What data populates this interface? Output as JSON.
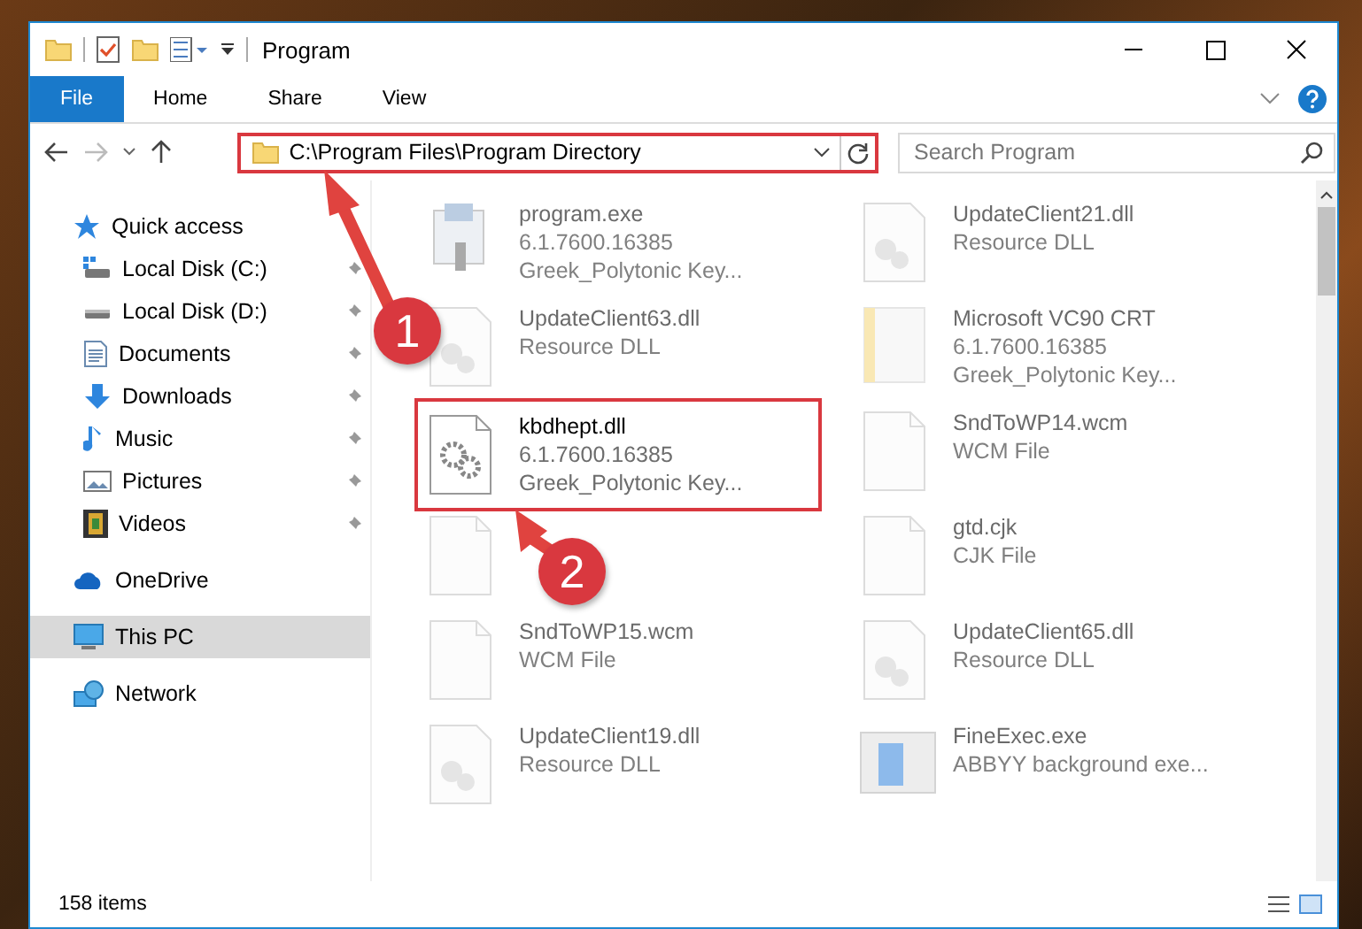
{
  "window": {
    "title": "Program"
  },
  "ribbon_tabs": [
    {
      "label": "File",
      "selected": true
    },
    {
      "label": "Home",
      "selected": false
    },
    {
      "label": "Share",
      "selected": false
    },
    {
      "label": "View",
      "selected": false
    }
  ],
  "address_bar": {
    "path": "C:\\Program Files\\Program Directory",
    "highlighted": true
  },
  "search": {
    "placeholder": "Search Program"
  },
  "nav": [
    {
      "label": "Quick access",
      "kind": "quick",
      "selected": false,
      "children": [
        {
          "label": "Local Disk (C:)",
          "kind": "disk-c",
          "pinned": true,
          "selected": false
        },
        {
          "label": "Local Disk (D:)",
          "kind": "disk",
          "pinned": true,
          "selected": false
        },
        {
          "label": "Documents",
          "kind": "documents",
          "pinned": true,
          "selected": false
        },
        {
          "label": "Downloads",
          "kind": "downloads",
          "pinned": true,
          "selected": false
        },
        {
          "label": "Music",
          "kind": "music",
          "pinned": true,
          "selected": false
        },
        {
          "label": "Pictures",
          "kind": "pictures",
          "pinned": true,
          "selected": false
        },
        {
          "label": "Videos",
          "kind": "videos",
          "pinned": true,
          "selected": false
        }
      ]
    },
    {
      "label": "OneDrive",
      "kind": "cloud",
      "selected": false
    },
    {
      "label": "This PC",
      "kind": "pc",
      "selected": true
    },
    {
      "label": "Network",
      "kind": "network",
      "selected": false
    }
  ],
  "files": [
    {
      "name": "program.exe",
      "kind": "exe",
      "highlighted": false,
      "details": [
        "6.1.7600.16385",
        "Greek_Polytonic Key..."
      ]
    },
    {
      "name": "UpdateClient21.dll",
      "kind": "dll",
      "highlighted": false,
      "details": [
        "Resource DLL"
      ]
    },
    {
      "name": "UpdateClient63.dll",
      "kind": "dll",
      "highlighted": false,
      "details": [
        "Resource DLL"
      ]
    },
    {
      "name": "Microsoft VC90 CRT",
      "kind": "folder",
      "highlighted": false,
      "details": [
        "6.1.7600.16385",
        "Greek_Polytonic Key..."
      ]
    },
    {
      "name": "kbdhept.dll",
      "kind": "gear",
      "highlighted": true,
      "details": [
        "6.1.7600.16385",
        "Greek_Polytonic Key..."
      ]
    },
    {
      "name": "SndToWP14.wcm",
      "kind": "file",
      "highlighted": false,
      "details": [
        "WCM File"
      ]
    },
    {
      "kind": "file",
      "highlighted": false
    },
    {
      "name": "gtd.cjk",
      "kind": "file",
      "highlighted": false,
      "details": [
        "CJK File"
      ]
    },
    {
      "name": "SndToWP15.wcm",
      "kind": "file",
      "highlighted": false,
      "details": [
        "WCM File"
      ]
    },
    {
      "name": "UpdateClient65.dll",
      "kind": "dll",
      "highlighted": false,
      "details": [
        "Resource DLL"
      ]
    },
    {
      "name": "UpdateClient19.dll",
      "kind": "dll",
      "highlighted": false,
      "details": [
        "Resource DLL"
      ]
    },
    {
      "name": "FineExec.exe",
      "kind": "app",
      "highlighted": false,
      "details": [
        "ABBYY background exe..."
      ]
    }
  ],
  "status_bar": {
    "item_count": "158 items"
  },
  "annotations": [
    {
      "number": "1"
    },
    {
      "number": "2"
    }
  ]
}
